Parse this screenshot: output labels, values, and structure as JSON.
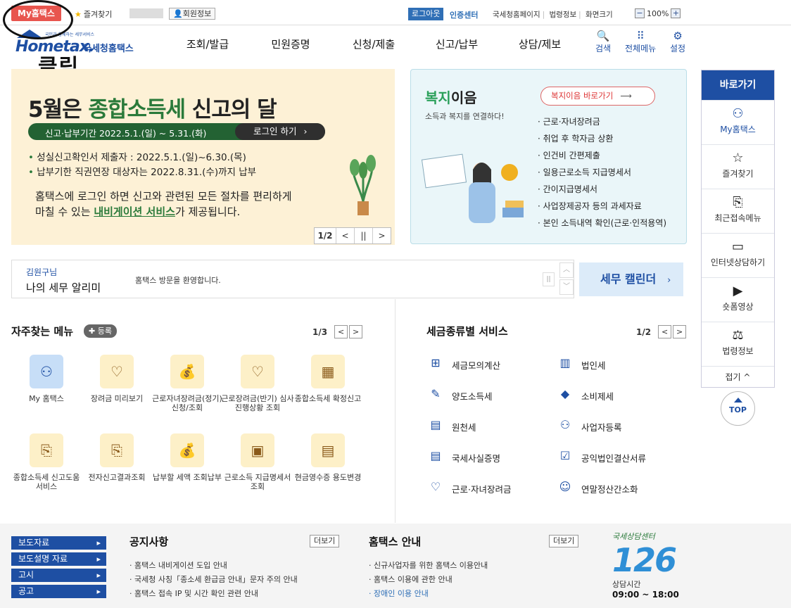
{
  "topbar": {
    "myhome": "My홈택스",
    "favorites": "즐겨찾기",
    "member_info": "회원정보",
    "logout": "로그아웃",
    "cert_center": "인증센터",
    "links": [
      "국세청홈페이지",
      "법령정보",
      "화면크기"
    ],
    "zoom_minus": "−",
    "zoom_level": "100%",
    "zoom_plus": "+"
  },
  "header": {
    "logo_tiny": "국민과 함께하는 세무서비스",
    "logo_main": "Hometax.",
    "logo_sub": "국세청홈택스",
    "nav": [
      "조회/발급",
      "민원증명",
      "신청/제출",
      "신고/납부",
      "상담/제보"
    ],
    "search": "검색",
    "all_menu": "전체메뉴",
    "settings": "설정"
  },
  "annotation": {
    "click_label": "클릭"
  },
  "banner": {
    "title_pre": "5월은 ",
    "title_hl": "종합소득세",
    "title_post": " 신고의 달",
    "period": "신고·납부기간  2022.5.1.(일) ~ 5.31.(화)",
    "login": "로그인 하기",
    "bullets": [
      "성실신고확인서 제출자 : 2022.5.1.(일)~6.30.(목)",
      "납부기한 직권연장 대상자는 2022.8.31.(수)까지 납부"
    ],
    "desc1": "홈택스에 로그인 하면 신고와 관련된 모든 절차를 편리하게",
    "desc2_pre": "마칠 수 있는 ",
    "desc2_link": "내비게이션 서비스",
    "desc2_post": "가 제공됩니다.",
    "page": "1/2",
    "prev": "<",
    "pause": "||",
    "next": ">"
  },
  "welfare": {
    "title_green": "복지",
    "title_rest": "이음",
    "subtitle": "소득과 복지를 연결하다!",
    "button": "복지이음 바로가기",
    "items": [
      "근로·자녀장려금",
      "취업 후 학자금 상환",
      "인건비 간편제출",
      "일용근로소득 지급명세서",
      "간이지급명세서",
      "사업장제공자 등의 과세자료",
      "본인 소득내역 확인(근로·인적용역)"
    ]
  },
  "sidebar": {
    "head": "바로가기",
    "items": [
      "My홈택스",
      "즐겨찾기",
      "최근접속메뉴",
      "인터넷상담하기",
      "숏폼영상",
      "법령정보"
    ],
    "fold": "접기 ^",
    "top": "TOP"
  },
  "notice": {
    "user": "김원구님",
    "title": "나의 세무 알리미",
    "message": "홈택스 방문을 환영합니다.",
    "calendar": "세무 캘린더"
  },
  "frequent": {
    "title": "자주찾는 메뉴",
    "register": "✚ 등록",
    "page": "1/3",
    "items": [
      "My 홈택스",
      "장려금 미리보기",
      "근로자녀장려금(정기) 신청/조회",
      "근로장려금(반기) 심사진행상황 조회",
      "종합소득세 확정신고",
      "종합소득세 신고도움 서비스",
      "전자신고결과조회",
      "납부할 세액 조회납부",
      "근로소득 지급명세서 조회",
      "현금영수증 용도변경"
    ]
  },
  "services": {
    "title": "세금종류별 서비스",
    "page": "1/2",
    "items": [
      "세금모의계산",
      "법인세",
      "양도소득세",
      "소비제세",
      "원천세",
      "사업자등록",
      "국세사실증명",
      "공익법인결산서류",
      "근로·자녀장려금",
      "연말정산간소화"
    ]
  },
  "bottom": {
    "buttons": [
      "보도자료",
      "보도설명 자료",
      "고시",
      "공고"
    ],
    "notice_title": "공지사항",
    "more": "더보기",
    "notices": [
      "홈택스 내비게이션 도입 안내",
      "국세청 사칭「종소세 환급금 안내」문자 주의 안내",
      "홈택스 접속 IP 및 시간 확인 관련 안내"
    ],
    "guide_title": "홈택스 안내",
    "guides": [
      "신규사업자를 위한 홈택스 이용안내",
      "홈택스 이용에 관한 안내",
      "장애인 이용 안내"
    ],
    "call_tag": "국세상담센터",
    "call_num": "126",
    "hours_label": "상담시간",
    "hours": "09:00 ~ 18:00"
  }
}
